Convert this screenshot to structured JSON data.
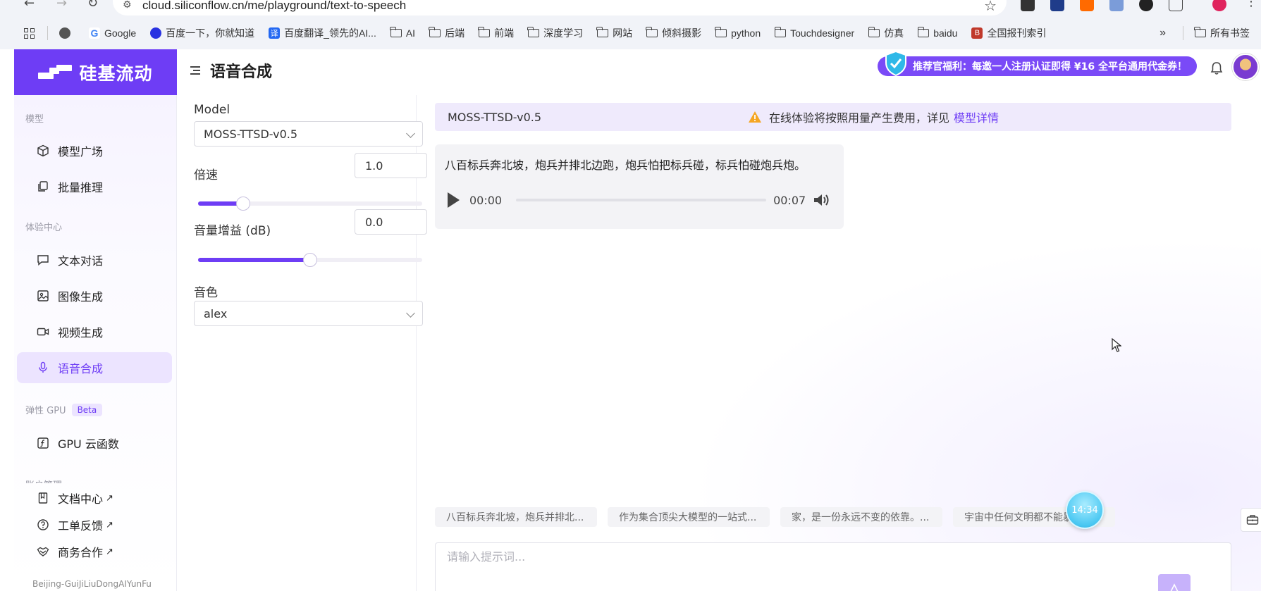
{
  "browser": {
    "url": "cloud.siliconflow.cn/me/playground/text-to-speech",
    "bookmarks": [
      "Google",
      "百度一下，你就知道",
      "百度翻译_领先的AI...",
      "AI",
      "后端",
      "前端",
      "深度学习",
      "网站",
      "倾斜摄影",
      "python",
      "Touchdesigner",
      "仿真",
      "baidu",
      "全国报刊索引"
    ],
    "more": "»",
    "all_bookmarks": "所有书签"
  },
  "brand": {
    "name": "硅基流动",
    "color": "#6e3df5"
  },
  "sidebar": {
    "section_model": "模型",
    "section_experience": "体验中心",
    "section_gpu": "弹性 GPU",
    "beta": "Beta",
    "section_account": "账户管理",
    "items": {
      "model_square": "模型广场",
      "batch_inference": "批量推理",
      "text_chat": "文本对话",
      "image_gen": "图像生成",
      "video_gen": "视频生成",
      "tts": "语音合成",
      "gpu_function": "GPU 云函数",
      "docs": "文档中心",
      "tickets": "工单反馈",
      "business": "商务合作",
      "ext_arrow": "↗"
    },
    "footer": "Beijing-GuiJiLiuDongAIYunFu"
  },
  "header": {
    "title": "语音合成",
    "promo": "推荐官福利：每邀一人注册认证即得 ¥16 全平台通用代金券！"
  },
  "controls": {
    "model_label": "Model",
    "model_value": "MOSS-TTSD-v0.5",
    "speed_label": "倍速",
    "speed_value": "1.0",
    "speed_fraction": 0.2,
    "gain_label": "音量增益 (dB)",
    "gain_value": "0.0",
    "gain_fraction": 0.5,
    "voice_label": "音色",
    "voice_value": "alex"
  },
  "main": {
    "model_name": "MOSS-TTSD-v0.5",
    "notice": "在线体验将按照用量产生费用，详见",
    "notice_link": "模型详情",
    "audio_text": "八百标兵奔北坡，炮兵并排北边跑，炮兵怕把标兵碰，标兵怕碰炮兵炮。",
    "time_current": "00:00",
    "time_total": "00:07",
    "progress_fraction": 0,
    "chips": [
      "八百标兵奔北坡，炮兵并排北...",
      "作为集合顶尖大模型的一站式...",
      "家，是一份永远不变的依靠。...",
      "宇宙中任何文明都不能暴露自..."
    ],
    "prompt_placeholder": "请输入提示词...",
    "timer": "14:34"
  }
}
